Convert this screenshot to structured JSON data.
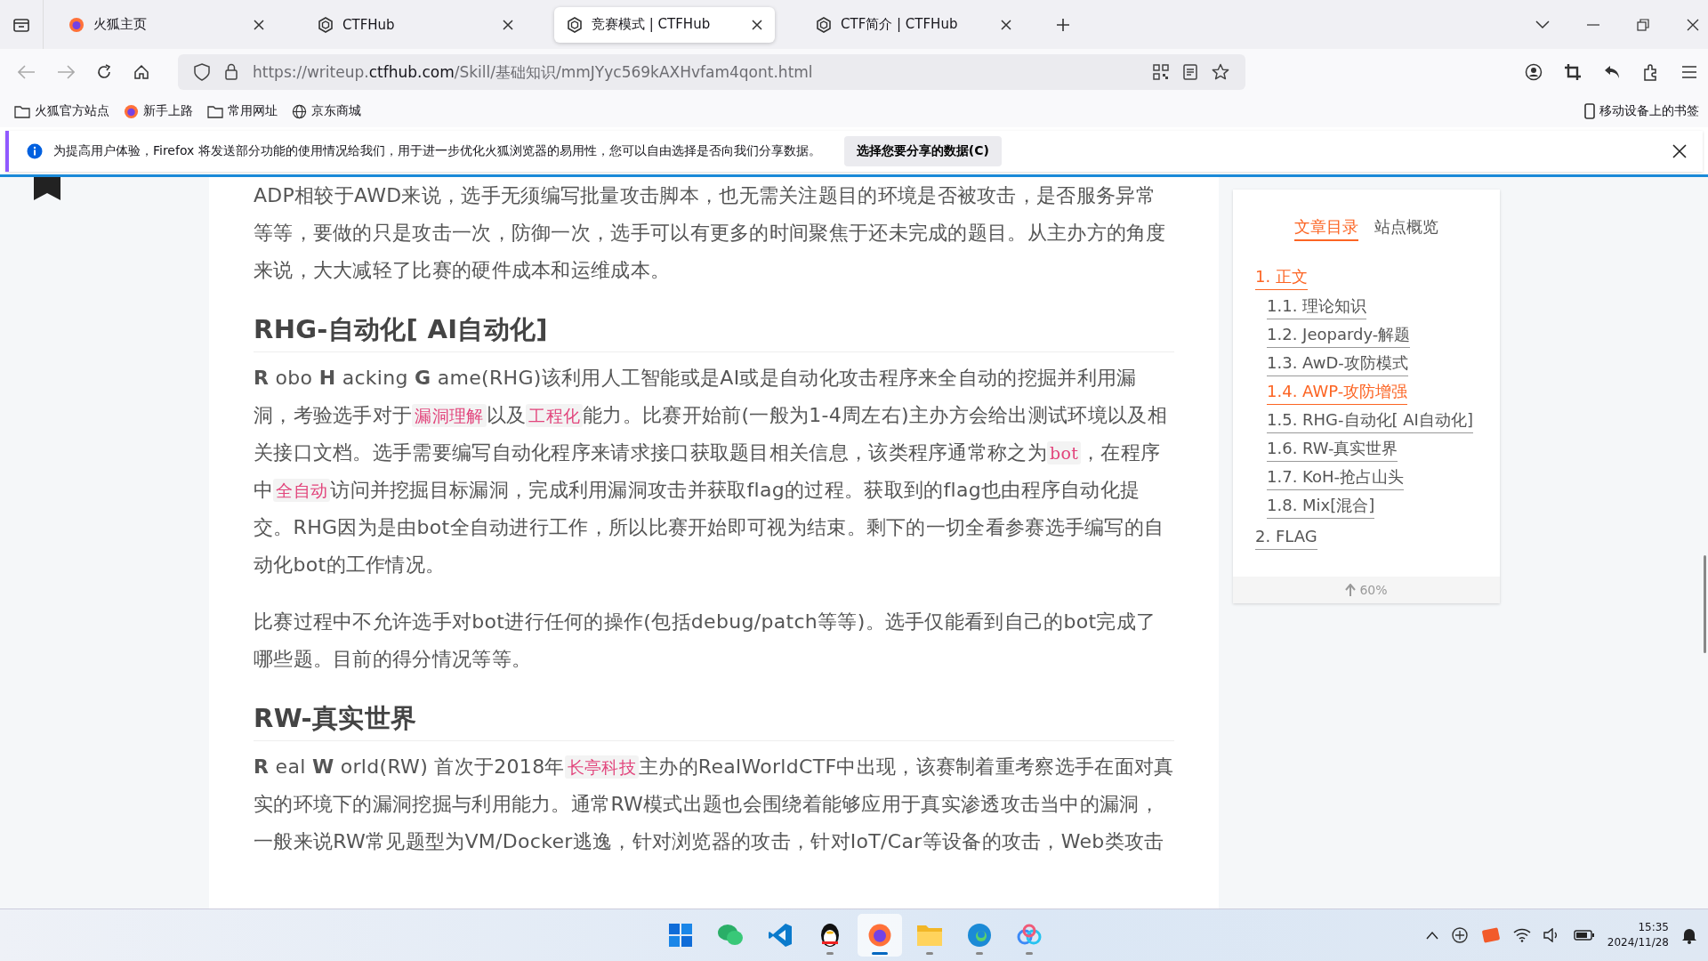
{
  "tabs": [
    {
      "title": "火狐主页",
      "kind": "firefox",
      "selected": false
    },
    {
      "title": "CTFHub",
      "kind": "site",
      "selected": false
    },
    {
      "title": "竞赛模式 | CTFHub",
      "kind": "site",
      "selected": true
    },
    {
      "title": "CTF简介 | CTFHub",
      "kind": "site",
      "selected": false
    }
  ],
  "address": {
    "url_start": "https://writeup.",
    "url_domain": "ctfhub.com",
    "url_end": "/Skill/基础知识/mmJYyc569kAXHvfam4qont.html"
  },
  "bookmarks": [
    {
      "label": "火狐官方站点",
      "kind": "folder"
    },
    {
      "label": "新手上路",
      "kind": "firefox"
    },
    {
      "label": "常用网址",
      "kind": "folder"
    },
    {
      "label": "京东商城",
      "kind": "link"
    }
  ],
  "mobile_bookmarks": "移动设备上的书签",
  "notification": {
    "message": "为提高用户体验，Firefox 将发送部分功能的使用情况给我们，用于进一步优化火狐浏览器的易用性，您可以自由选择是否向我们分享数据。",
    "button": "选择您要分享的数据(C)"
  },
  "article": [
    {
      "kind": "paragraph",
      "segments": [
        {
          "kind": "text",
          "text": "ADP相较于AWD来说，选手无须编写批量攻击脚本，也无需关注题目的环境是否被攻击，是否服务异常等等，要做的只是攻击一次，防御一次，选手可以有更多的时间聚焦于还未完成的题目。从主办方的角度来说，大大减轻了比赛的硬件成本和运维成本。"
        }
      ]
    },
    {
      "kind": "heading",
      "text": "RHG-自动化[ AI自动化]"
    },
    {
      "kind": "paragraph",
      "segments": [
        {
          "kind": "text",
          "text": "**R** obo **H** acking **G** ame(RHG)该利用人工智能或是AI或是自动化攻击程序来全自动的挖掘并利用漏洞，考验选手对于"
        },
        {
          "kind": "code",
          "text": "漏洞理解"
        },
        {
          "kind": "text",
          "text": "以及"
        },
        {
          "kind": "code",
          "text": "工程化"
        },
        {
          "kind": "text",
          "text": "能力。比赛开始前(一般为1-4周左右)主办方会给出测试环境以及相关接口文档。选手需要编写自动化程序来请求接口获取题目相关信息，该类程序通常称之为"
        },
        {
          "kind": "code",
          "text": "bot"
        },
        {
          "kind": "text",
          "text": "，在程序中"
        },
        {
          "kind": "code",
          "text": "全自动"
        },
        {
          "kind": "text",
          "text": "访问并挖掘目标漏洞，完成利用漏洞攻击并获取flag的过程。获取到的flag也由程序自动化提交。RHG因为是由bot全自动进行工作，所以比赛开始即可视为结束。剩下的一切全看参赛选手编写的自动化bot的工作情况。"
        }
      ]
    },
    {
      "kind": "paragraph",
      "segments": [
        {
          "kind": "text",
          "text": "比赛过程中不允许选手对bot进行任何的操作(包括debug/patch等等)。选手仅能看到自己的bot完成了哪些题。目前的得分情况等等。"
        }
      ]
    },
    {
      "kind": "heading",
      "text": "RW-真实世界"
    },
    {
      "kind": "paragraph",
      "segments": [
        {
          "kind": "text",
          "text": "**R** eal **W** orld(RW) 首次于2018年"
        },
        {
          "kind": "code",
          "text": "长亭科技"
        },
        {
          "kind": "text",
          "text": "主办的RealWorldCTF中出现，该赛制着重考察选手在面对真实的环境下的漏洞挖掘与利用能力。通常RW模式出题也会围绕着能够应用于真实渗透攻击当中的漏洞，一般来说RW常见题型为VM/Docker逃逸，针对浏览器的攻击，针对IoT/Car等设备的攻击，Web类攻击"
        }
      ]
    }
  ],
  "toc": {
    "tabs": [
      {
        "label": "文章目录",
        "selected": true
      },
      {
        "label": "站点概览",
        "selected": false
      }
    ],
    "items": [
      {
        "label": "1. 正文",
        "active": true,
        "children": [
          {
            "label": "1.1. 理论知识",
            "active": false
          },
          {
            "label": "1.2. Jeopardy-解题",
            "active": false
          },
          {
            "label": "1.3. AwD-攻防模式",
            "active": false
          },
          {
            "label": "1.4. AWP-攻防增强",
            "active": true
          },
          {
            "label": "1.5. RHG-自动化[ AI自动化]",
            "active": false
          },
          {
            "label": "1.6. RW-真实世界",
            "active": false
          },
          {
            "label": "1.7. KoH-抢占山头",
            "active": false
          },
          {
            "label": "1.8. Mix[混合]",
            "active": false
          }
        ]
      },
      {
        "label": "2. FLAG",
        "active": false
      }
    ],
    "progress": "60%"
  },
  "taskbar": {
    "apps": [
      {
        "kind": "windows",
        "running": false,
        "active": false
      },
      {
        "kind": "chat",
        "running": false,
        "active": false
      },
      {
        "kind": "code",
        "running": false,
        "active": false
      },
      {
        "kind": "penguin",
        "running": true,
        "active": false
      },
      {
        "kind": "firefox",
        "running": true,
        "active": true
      },
      {
        "kind": "folder",
        "running": true,
        "active": false
      },
      {
        "kind": "edge",
        "running": true,
        "active": false
      },
      {
        "kind": "cloud",
        "running": true,
        "active": false
      }
    ],
    "time": "15:35",
    "date": "2024/11/28"
  }
}
